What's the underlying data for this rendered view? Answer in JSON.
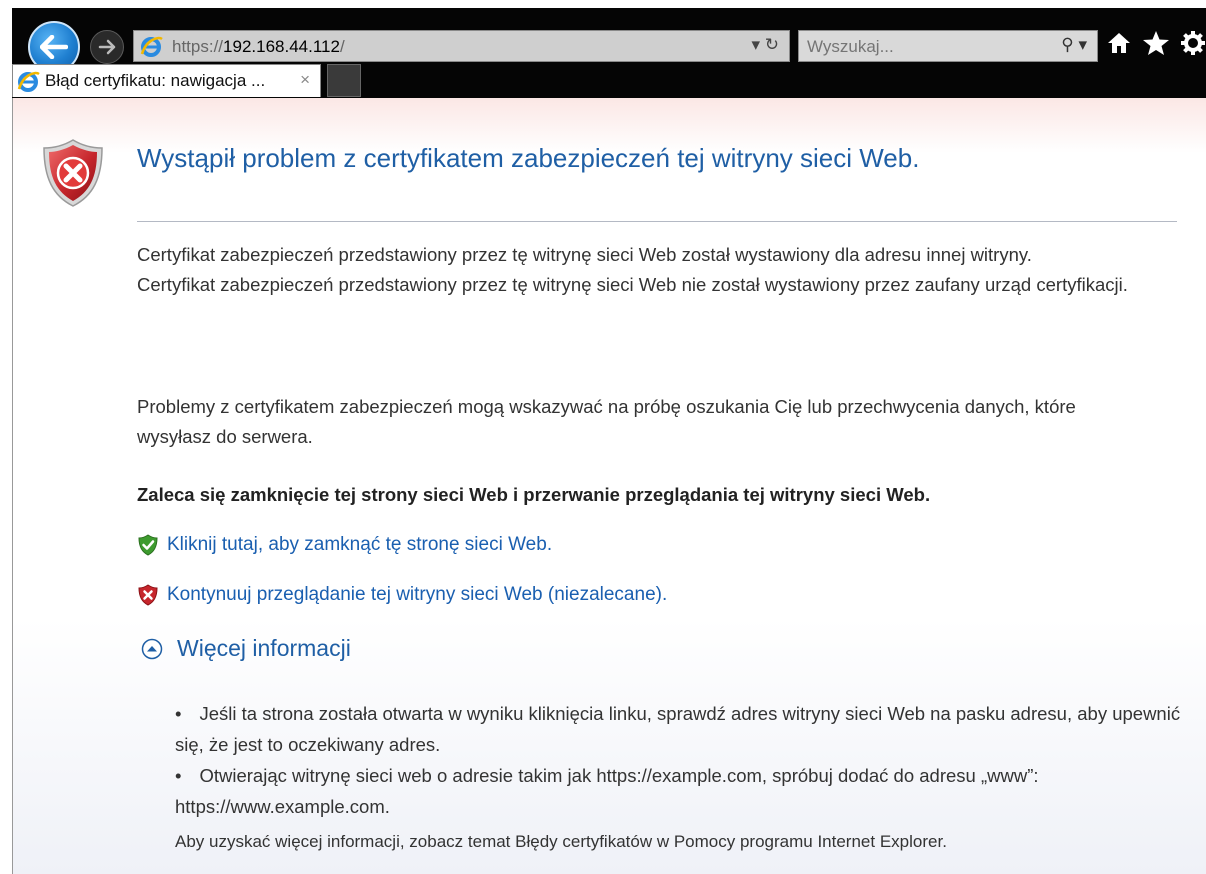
{
  "browser": {
    "url_protocol": "https://",
    "url_host": "192.168.44.112",
    "url_path": "/",
    "address_controls": "▾ ↻",
    "search_placeholder": "Wyszukaj...",
    "search_controls": "⚲ ▾",
    "tab_title": "Błąd certyfikatu: nawigacja ...",
    "tab_close": "×",
    "icons": [
      "back-icon",
      "forward-icon",
      "ie-logo-icon",
      "refresh-icon",
      "search-icon",
      "home-icon",
      "favorites-star-icon",
      "settings-gear-icon"
    ]
  },
  "page": {
    "title": "Wystąpił problem z certyfikatem zabezpieczeń tej witryny sieci Web.",
    "paragraph1_line1": "Certyfikat zabezpieczeń przedstawiony przez tę witrynę sieci Web został wystawiony dla adresu innej witryny.",
    "paragraph1_line2": "Certyfikat zabezpieczeń przedstawiony przez tę witrynę sieci Web nie został wystawiony przez zaufany urząd certyfikacji.",
    "paragraph2": "Problemy z certyfikatem zabezpieczeń mogą wskazywać na próbę oszukania Cię lub przechwycenia danych, które wysyłasz do serwera.",
    "recommendation": "Zaleca się zamknięcie tej strony sieci Web i przerwanie przeglądania tej witryny sieci Web.",
    "close_link": "Kliknij tutaj, aby zamknąć tę stronę sieci Web.",
    "continue_link": "Kontynuuj przeglądanie tej witryny sieci Web (niezalecane).",
    "more_info": "Więcej informacji",
    "bullet": "•",
    "info_item1": "Jeśli ta strona została otwarta w wyniku kliknięcia linku, sprawdź adres witryny sieci Web na pasku adresu, aby upewnić się, że jest to oczekiwany adres.",
    "info_item2": "Otwierając witrynę sieci web o adresie takim jak https://example.com, spróbuj dodać do adresu „www”: https://www.example.com.",
    "help_text": "Aby uzyskać więcej informacji, zobacz temat Błędy certyfikatów w Pomocy programu Internet Explorer."
  },
  "colors": {
    "title_blue": "#1f5fa5",
    "link_blue": "#1a5fb0",
    "error_red": "#c6262c",
    "ok_green": "#3e9b2f",
    "chrome_black": "#050505"
  }
}
